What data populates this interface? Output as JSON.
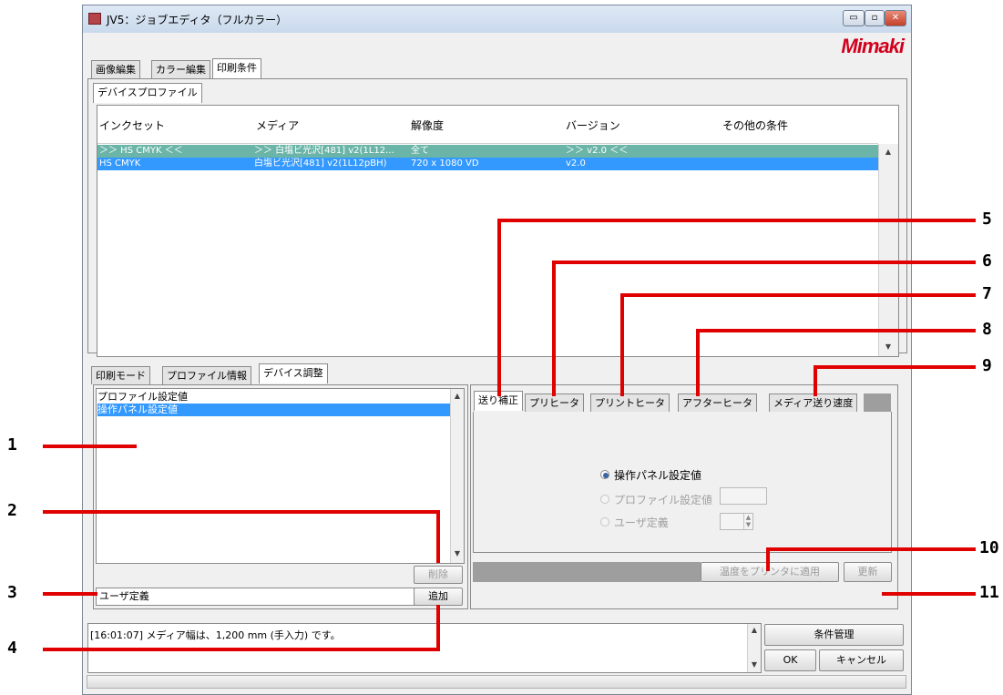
{
  "window": {
    "title": "JV5：ジョブエディタ（フルカラー）",
    "logo": "Mimaki",
    "controls": {
      "minimize": "▭",
      "maximize": "▫",
      "close": "✕"
    }
  },
  "main_tabs": [
    "画像編集",
    "カラー編集",
    "印刷条件"
  ],
  "profile_tab": "デバイスプロファイル",
  "table": {
    "columns": [
      "インクセット",
      "メディア",
      "解像度",
      "バージョン",
      "その他の条件"
    ],
    "rows": [
      [
        "＞＞ HS CMYK ＜＜",
        "＞＞ 白塩ビ光沢[481] v2(1L12...",
        "全て",
        "＞＞ v2.0 ＜＜",
        ""
      ],
      [
        "HS CMYK",
        "白塩ビ光沢[481] v2(1L12pBH)",
        "720 x 1080 VD",
        "v2.0",
        ""
      ]
    ]
  },
  "lower_tabs": [
    "印刷モード",
    "プロファイル情報",
    "デバイス調整"
  ],
  "list": {
    "items": [
      "プロファイル設定値",
      "操作パネル設定値"
    ]
  },
  "buttons": {
    "delete": "削除",
    "add": "追加",
    "apply_temp": "温度をプリンタに適用",
    "update": "更新",
    "condition_mgmt": "条件管理",
    "ok": "OK",
    "cancel": "キャンセル"
  },
  "user_def_input": "ユーザ定義",
  "device_tabs": [
    "送り補正",
    "プリヒータ",
    "プリントヒータ",
    "アフターヒータ",
    "メディア送り速度"
  ],
  "radios": {
    "panel": "操作パネル設定値",
    "profile": "プロファイル設定値",
    "user": "ユーザ定義"
  },
  "log_text": "[16:01:07] メディア幅は、1,200 mm (手入力) です。",
  "callouts": [
    "1",
    "2",
    "3",
    "4",
    "5",
    "6",
    "7",
    "8",
    "9",
    "10",
    "11"
  ],
  "colors": {
    "callout_line": "#e00000",
    "selected_row": "#3399ff",
    "filter_row": "#6bb5a8",
    "logo": "#d3001d"
  }
}
